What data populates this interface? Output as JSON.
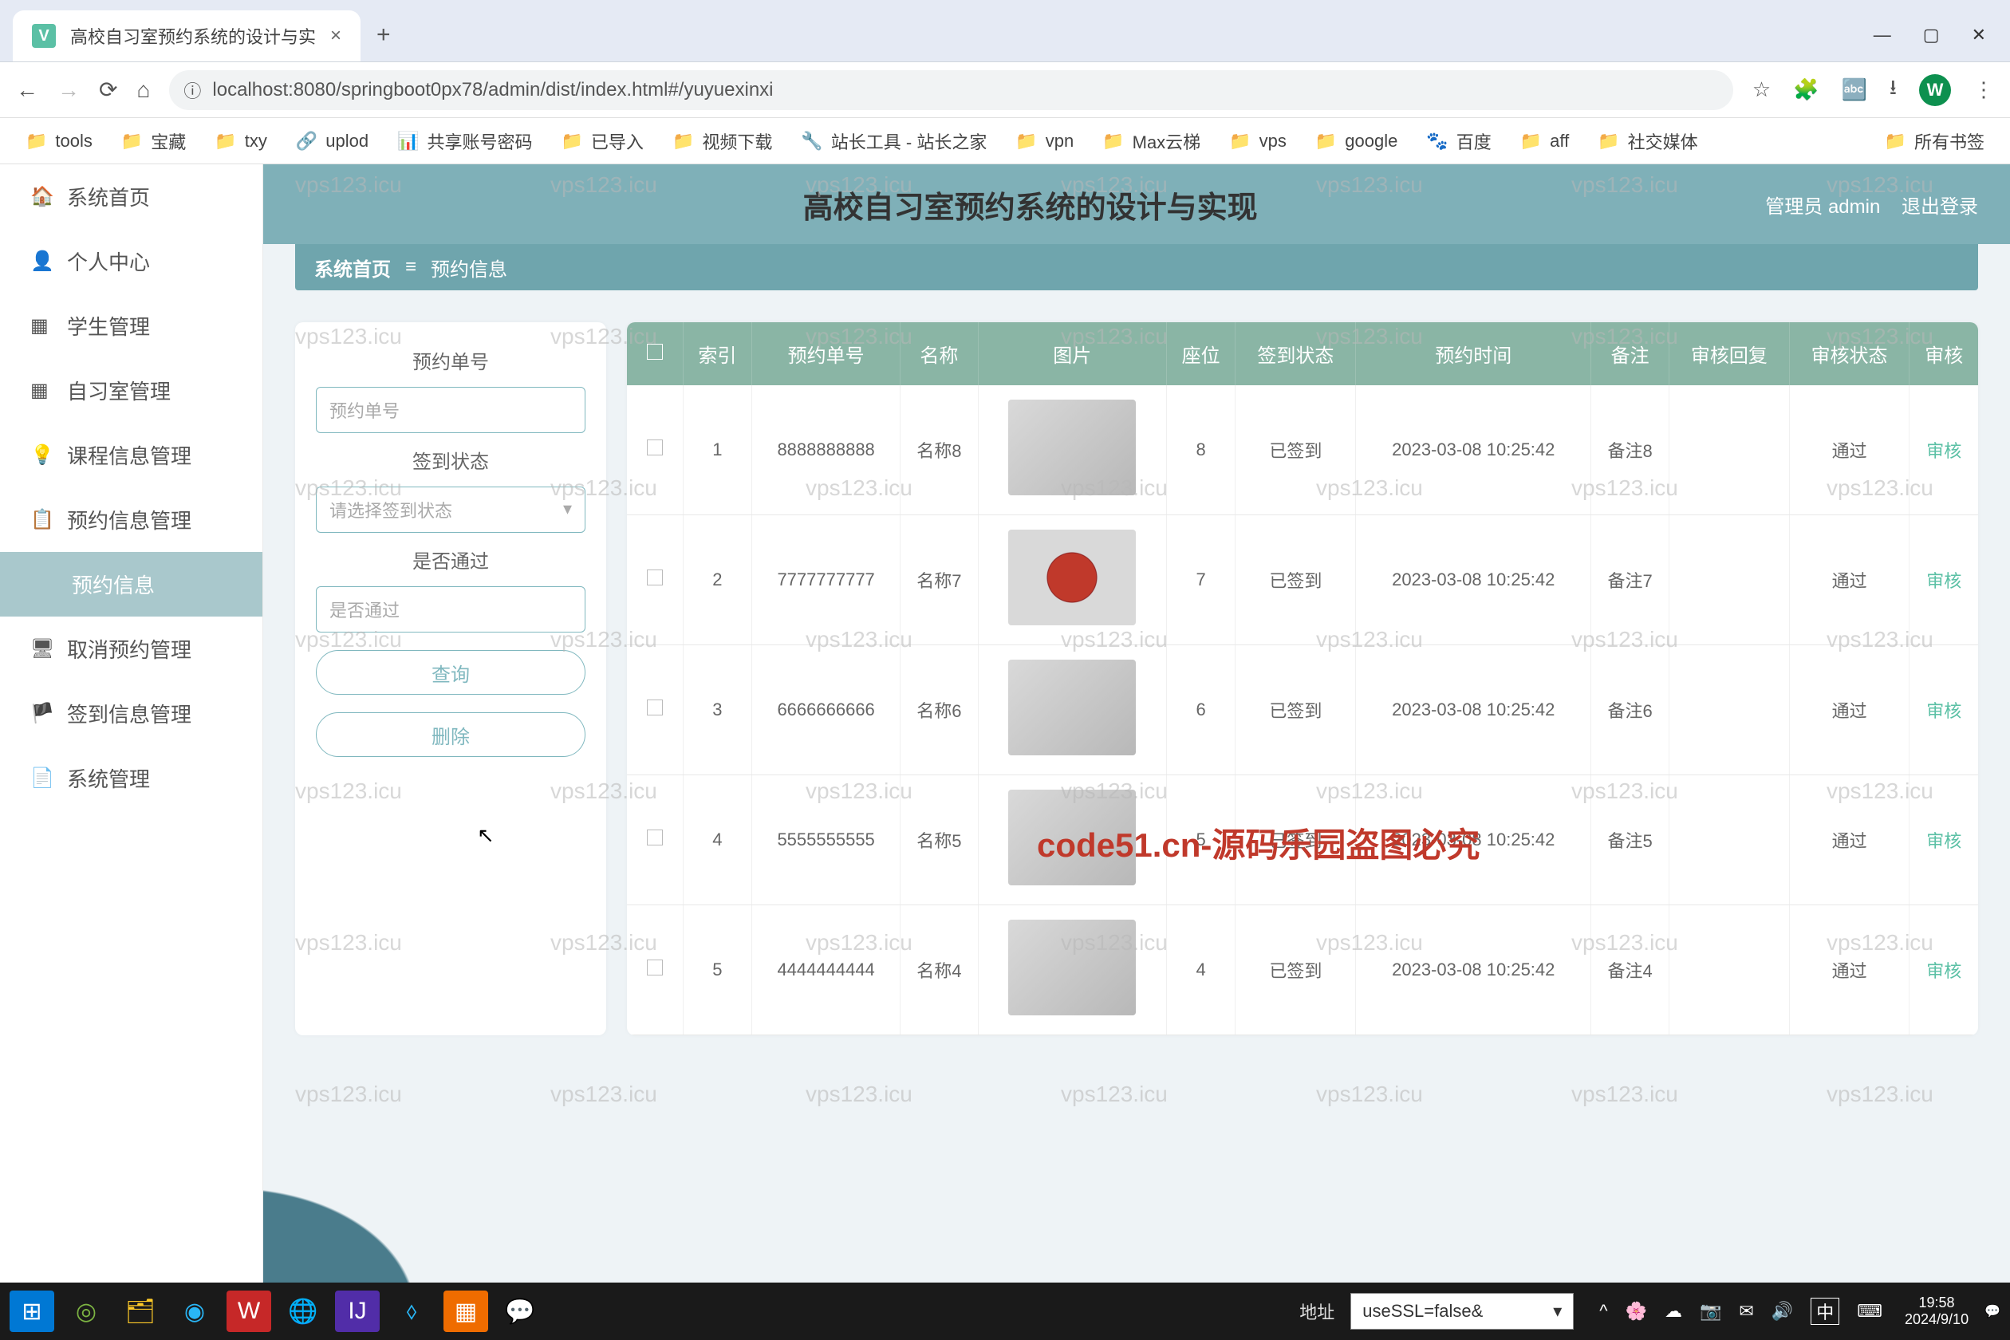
{
  "browser": {
    "tab_title": "高校自习室预约系统的设计与实",
    "url": "localhost:8080/springboot0px78/admin/dist/index.html#/yuyuexinxi",
    "avatar_letter": "W"
  },
  "bookmarks": [
    {
      "icon": "📁",
      "label": "tools"
    },
    {
      "icon": "📁",
      "label": "宝藏"
    },
    {
      "icon": "📁",
      "label": "txy"
    },
    {
      "icon": "🔗",
      "label": "uplod"
    },
    {
      "icon": "📊",
      "label": "共享账号密码"
    },
    {
      "icon": "📁",
      "label": "已导入"
    },
    {
      "icon": "📁",
      "label": "视频下载"
    },
    {
      "icon": "🔧",
      "label": "站长工具 - 站长之家"
    },
    {
      "icon": "📁",
      "label": "vpn"
    },
    {
      "icon": "📁",
      "label": "Max云梯"
    },
    {
      "icon": "📁",
      "label": "vps"
    },
    {
      "icon": "📁",
      "label": "google"
    },
    {
      "icon": "🐾",
      "label": "百度"
    },
    {
      "icon": "📁",
      "label": "aff"
    },
    {
      "icon": "📁",
      "label": "社交媒体"
    }
  ],
  "bookmarks_right": {
    "icon": "📁",
    "label": "所有书签"
  },
  "sidebar": [
    {
      "icon": "🏠",
      "label": "系统首页"
    },
    {
      "icon": "👤",
      "label": "个人中心"
    },
    {
      "icon": "▦",
      "label": "学生管理"
    },
    {
      "icon": "▦",
      "label": "自习室管理"
    },
    {
      "icon": "💡",
      "label": "课程信息管理"
    },
    {
      "icon": "📋",
      "label": "预约信息管理"
    },
    {
      "icon": "",
      "label": "预约信息",
      "sub": true,
      "active": true
    },
    {
      "icon": "🖥",
      "label": "取消预约管理"
    },
    {
      "icon": "🏴",
      "label": "签到信息管理"
    },
    {
      "icon": "📄",
      "label": "系统管理"
    }
  ],
  "header": {
    "title": "高校自习室预约系统的设计与实现",
    "role": "管理员",
    "user": "admin",
    "logout": "退出登录"
  },
  "breadcrumb": {
    "home": "系统首页",
    "sep": "≡",
    "current": "预约信息"
  },
  "filter": {
    "label1": "预约单号",
    "ph1": "预约单号",
    "label2": "签到状态",
    "ph2": "请选择签到状态",
    "label3": "是否通过",
    "ph3": "是否通过",
    "btn_query": "查询",
    "btn_delete": "删除"
  },
  "table": {
    "headers": [
      "",
      "索引",
      "预约单号",
      "名称",
      "图片",
      "座位",
      "签到状态",
      "预约时间",
      "备注",
      "审核回复",
      "审核状态",
      "审核"
    ],
    "rows": [
      {
        "idx": "1",
        "no": "8888888888",
        "name": "名称8",
        "seat": "8",
        "sign": "已签到",
        "time": "2023-03-08 10:25:42",
        "note": "备注8",
        "reply": "",
        "status": "通过",
        "action": "审核"
      },
      {
        "idx": "2",
        "no": "7777777777",
        "name": "名称7",
        "seat": "7",
        "sign": "已签到",
        "time": "2023-03-08 10:25:42",
        "note": "备注7",
        "reply": "",
        "status": "通过",
        "action": "审核"
      },
      {
        "idx": "3",
        "no": "6666666666",
        "name": "名称6",
        "seat": "6",
        "sign": "已签到",
        "time": "2023-03-08 10:25:42",
        "note": "备注6",
        "reply": "",
        "status": "通过",
        "action": "审核"
      },
      {
        "idx": "4",
        "no": "5555555555",
        "name": "名称5",
        "seat": "5",
        "sign": "已签到",
        "time": "2023-03-08 10:25:42",
        "note": "备注5",
        "reply": "",
        "status": "通过",
        "action": "审核"
      },
      {
        "idx": "5",
        "no": "4444444444",
        "name": "名称4",
        "seat": "4",
        "sign": "已签到",
        "time": "2023-03-08 10:25:42",
        "note": "备注4",
        "reply": "",
        "status": "通过",
        "action": "审核"
      }
    ]
  },
  "watermark": "vps123.icu",
  "watermark_big": "code51.cn-源码乐园盗图必究",
  "taskbar": {
    "addr_label": "地址",
    "addr_value": "useSSL=false&",
    "ime": "中",
    "time": "19:58",
    "date": "2024/9/10"
  }
}
